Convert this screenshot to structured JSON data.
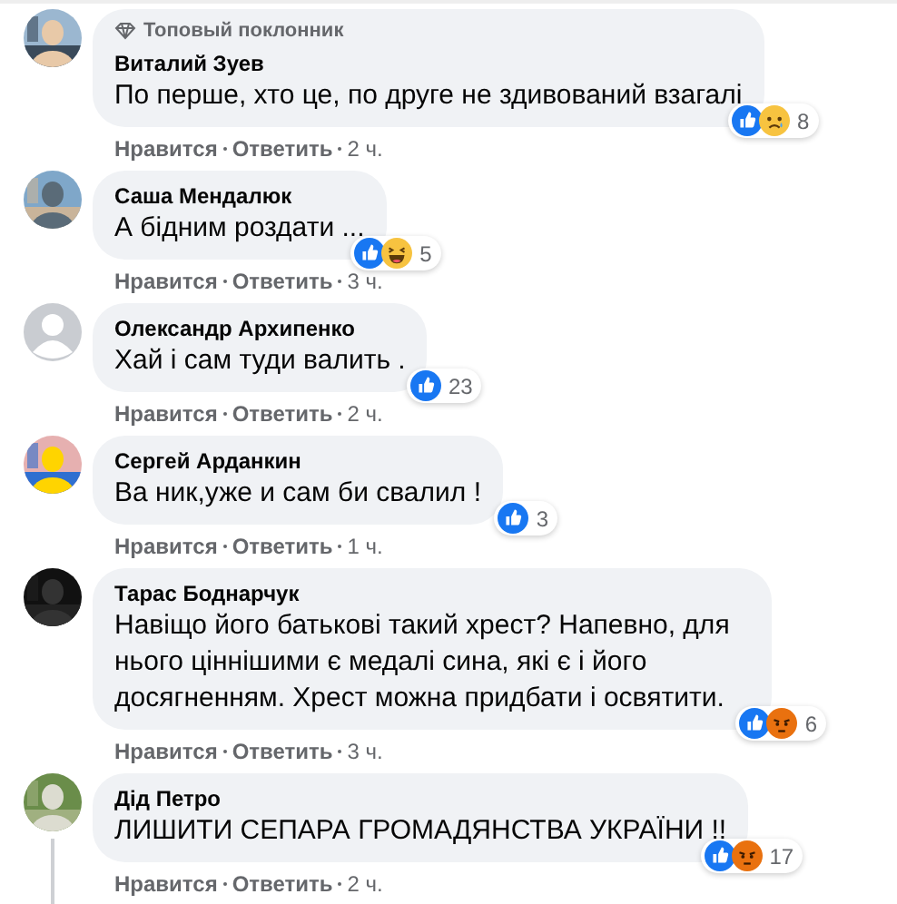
{
  "comments": [
    {
      "avatar": {
        "kind": "picture"
      },
      "badge": "Топовый поклонник",
      "author": "Виталий Зуев",
      "text": "По перше, хто це, по друге не здивований взагалі",
      "reactions": [
        {
          "kind": "like"
        },
        {
          "kind": "sad"
        }
      ],
      "count": "8",
      "like": "Нравится",
      "reply": "Ответить",
      "time": "2 ч.",
      "thread": false
    },
    {
      "avatar": {
        "kind": "picture"
      },
      "author": "Саша Мендалюк",
      "text": "А бідним роздати ...",
      "reactions": [
        {
          "kind": "like"
        },
        {
          "kind": "haha"
        }
      ],
      "count": "5",
      "like": "Нравится",
      "reply": "Ответить",
      "time": "3 ч.",
      "thread": false
    },
    {
      "avatar": {
        "kind": "default"
      },
      "author": "Олександр Архипенко",
      "text": "Хай і сам туди валить .",
      "reactions": [
        {
          "kind": "like"
        }
      ],
      "count": "23",
      "like": "Нравится",
      "reply": "Ответить",
      "time": "2 ч.",
      "thread": false
    },
    {
      "avatar": {
        "kind": "picture"
      },
      "author": "Сергей Арданкин",
      "text": "Ва ник,уже и сам би свалил !",
      "reactions": [
        {
          "kind": "like"
        }
      ],
      "count": "3",
      "like": "Нравится",
      "reply": "Ответить",
      "time": "1 ч.",
      "thread": false
    },
    {
      "avatar": {
        "kind": "picture"
      },
      "author": "Тарас Боднарчук",
      "text": "Навіщо його батькові такий хрест? Напевно, для нього ціннішими є медалі сина, які є і його досягненням. Хрест можна придбати і освятити.",
      "reactions": [
        {
          "kind": "like"
        },
        {
          "kind": "angry"
        }
      ],
      "count": "6",
      "like": "Нравится",
      "reply": "Ответить",
      "time": "3 ч.",
      "thread": false
    },
    {
      "avatar": {
        "kind": "picture"
      },
      "author": "Дід Петро",
      "text": "ЛИШИТИ СЕПАРА ГРОМАДЯНСТВА УКРАЇНИ !!",
      "reactions": [
        {
          "kind": "like"
        },
        {
          "kind": "angry"
        }
      ],
      "count": "17",
      "like": "Нравится",
      "reply": "Ответить",
      "time": "2 ч.",
      "thread": true
    }
  ]
}
